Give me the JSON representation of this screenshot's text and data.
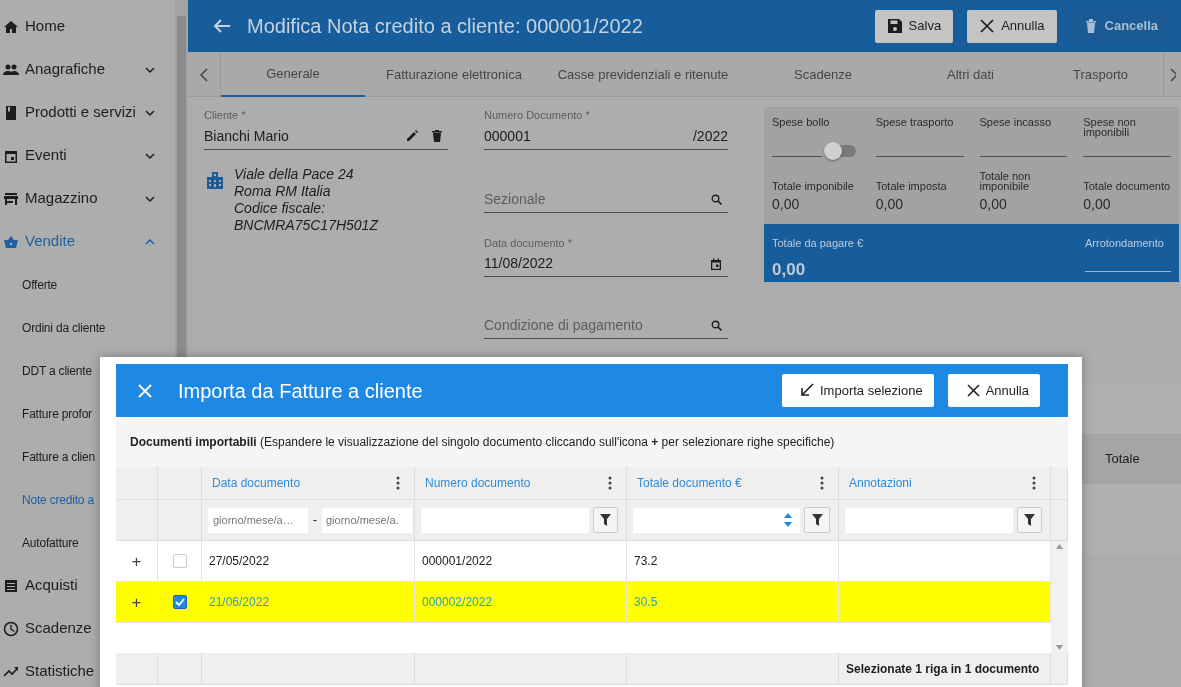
{
  "sidebar": {
    "items": [
      {
        "label": "Home",
        "selected": false
      },
      {
        "label": "Anagrafiche",
        "selected": false,
        "expanded": false
      },
      {
        "label": "Prodotti e servizi",
        "selected": false,
        "expanded": false
      },
      {
        "label": "Eventi",
        "selected": false,
        "expanded": false
      },
      {
        "label": "Magazzino",
        "selected": false,
        "expanded": false
      },
      {
        "label": "Vendite",
        "selected": true,
        "expanded": true,
        "children": [
          {
            "label": "Offerte",
            "selected": false
          },
          {
            "label": "Ordini da cliente",
            "selected": false
          },
          {
            "label": "DDT a cliente",
            "selected": false
          },
          {
            "label": "Fatture profor",
            "selected": false
          },
          {
            "label": "Fatture a clien",
            "selected": false
          },
          {
            "label": "Note credito a",
            "selected": true
          },
          {
            "label": "Autofatture",
            "selected": false
          }
        ]
      },
      {
        "label": "Acquisti",
        "selected": false
      },
      {
        "label": "Scadenze",
        "selected": false
      },
      {
        "label": "Statistiche",
        "selected": false
      }
    ]
  },
  "header": {
    "title": "Modifica Nota credito a cliente: 000001/2022",
    "buttons": [
      {
        "label": "Salva",
        "kind": "save"
      },
      {
        "label": "Annulla",
        "kind": "cancel"
      },
      {
        "label": "Cancella",
        "kind": "delete"
      }
    ]
  },
  "tabs": [
    {
      "label": "Generale",
      "selected": true
    },
    {
      "label": "Fatturazione elettronica",
      "selected": false
    },
    {
      "label": "Casse previdenziali e ritenute",
      "selected": false
    },
    {
      "label": "Scadenze",
      "selected": false
    },
    {
      "label": "Altri dati",
      "selected": false
    },
    {
      "label": "Trasporto",
      "selected": false
    }
  ],
  "form": {
    "cliente": {
      "label": "Cliente *",
      "value": "Bianchi Mario"
    },
    "address": [
      "Viale della Pace 24",
      "Roma RM Italia",
      "Codice fiscale:",
      "BNCMRA75C17H501Z"
    ],
    "numero": {
      "label": "Numero Documento *",
      "value": "000001",
      "suffix": "/2022"
    },
    "sezionale": {
      "placeholder": "Sezionale"
    },
    "data": {
      "label": "Data documento *",
      "value": "11/08/2022"
    },
    "condizione": {
      "placeholder": "Condizione di pagamento"
    }
  },
  "summary": {
    "spese": [
      {
        "label": "Spese bollo",
        "kind": "toggle",
        "on": false
      },
      {
        "label": "Spese trasporto",
        "kind": "field"
      },
      {
        "label": "Spese incasso",
        "kind": "field"
      },
      {
        "label": "Spese non imponibili",
        "kind": "field"
      }
    ],
    "totals": [
      {
        "label": "Totale imponibile",
        "value": "0,00"
      },
      {
        "label": "Totale imposta",
        "value": "0,00"
      },
      {
        "label": "Totale non imponibile",
        "value": "0,00"
      },
      {
        "label": "Totale documento",
        "value": "0,00"
      }
    ],
    "da_pagare": {
      "label": "Totale da pagare €",
      "value": "0,00"
    },
    "arrotondamento": {
      "label": "Arrotondamento"
    }
  },
  "background_table": {
    "column": "Totale"
  },
  "dialog": {
    "title": "Importa da Fatture a cliente",
    "buttons": [
      {
        "label": "Importa selezione",
        "kind": "import"
      },
      {
        "label": "Annulla",
        "kind": "cancel"
      }
    ],
    "note": "**Documenti importabili** (Espandere le visualizzazione del singolo documento cliccando sull'icona **+** per selezionare righe specifiche)",
    "columns": [
      {
        "label": "Data documento"
      },
      {
        "label": "Numero documento"
      },
      {
        "label": "Totale documento €"
      },
      {
        "label": "Annotazioni"
      }
    ],
    "filters": {
      "date_from": {
        "placeholder": "giorno/mese/a…"
      },
      "separator": "-",
      "date_to": {
        "placeholder": "giorno/mese/a."
      }
    },
    "rows": [
      {
        "expand": "+",
        "checked": false,
        "selected": false,
        "cells": [
          "27/05/2022",
          "000001/2022",
          "73.2",
          ""
        ]
      },
      {
        "expand": "+",
        "checked": true,
        "selected": true,
        "cells": [
          "21/06/2022",
          "000002/2022",
          "30.5",
          ""
        ]
      }
    ],
    "footer": "Selezionate 1 riga in 1 documento"
  }
}
